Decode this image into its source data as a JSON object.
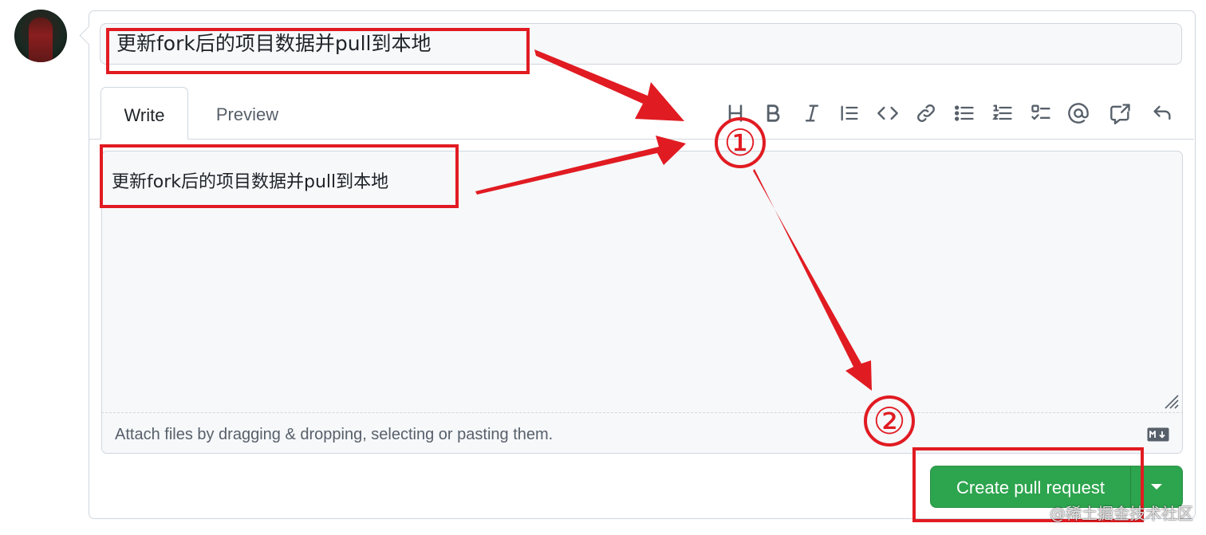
{
  "pr_form": {
    "title_value": "更新fork后的项目数据并pull到本地",
    "tabs": [
      {
        "label": "Write",
        "active": true
      },
      {
        "label": "Preview",
        "active": false
      }
    ],
    "toolbar_icons": [
      "heading-icon",
      "bold-icon",
      "italic-icon",
      "quote-icon",
      "code-icon",
      "link-icon",
      "unordered-list-icon",
      "ordered-list-icon",
      "task-list-icon",
      "mention-icon",
      "cross-reference-icon",
      "undo-icon"
    ],
    "body_value": "更新fork后的项目数据并pull到本地",
    "attach_hint": "Attach files by dragging & dropping, selecting or pasting them.",
    "create_button_label": "Create pull request"
  },
  "annotations": {
    "step1": "①",
    "step2": "②",
    "color": "#e11b22"
  },
  "watermark": "@稀土掘金技术社区",
  "colors": {
    "primary_button": "#2da44e",
    "border": "#d0d7de",
    "muted_text": "#57606a"
  }
}
